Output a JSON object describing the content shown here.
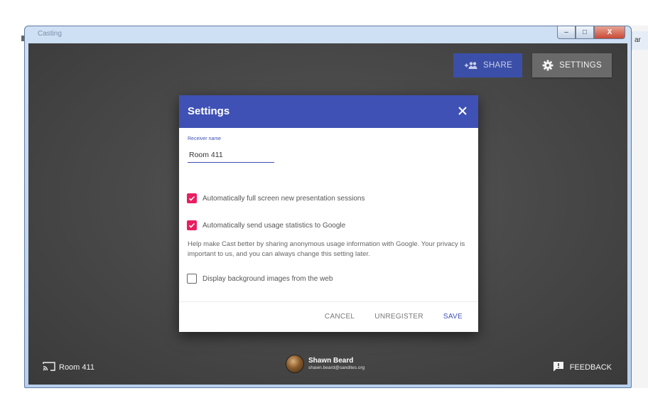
{
  "window": {
    "title": "Casting",
    "controls": {
      "minimize": "–",
      "maximize": "□",
      "close": "X"
    }
  },
  "desktop": {
    "right_tab_text": "ar"
  },
  "toolbar": {
    "share_label": "SHARE",
    "settings_label": "SETTINGS"
  },
  "dialog": {
    "title": "Settings",
    "receiver_label": "Receiver name",
    "receiver_value": "Room 411",
    "options": [
      {
        "label": "Automatically full screen new presentation sessions",
        "checked": true
      },
      {
        "label": "Automatically send usage statistics to Google",
        "checked": true
      },
      {
        "label": "Display background images from the web",
        "checked": false
      }
    ],
    "help_text": "Help make Cast better by sharing anonymous usage information with Google. Your privacy is important to us, and you can always change this setting later.",
    "actions": {
      "cancel": "CANCEL",
      "unregister": "UNREGISTER",
      "save": "SAVE"
    }
  },
  "footer": {
    "receiver": "Room 411",
    "user_name": "Shawn Beard",
    "user_email": "shawn.beard@sandites.org",
    "feedback": "FEEDBACK"
  },
  "colors": {
    "accent": "#3f51b5",
    "checkbox": "#e91e63",
    "background": "#4a4a4a"
  },
  "icons": {
    "share": "add-people-icon",
    "settings": "gear-icon",
    "close": "close-icon",
    "cast": "cast-icon",
    "feedback": "feedback-icon",
    "check": "check-icon"
  }
}
